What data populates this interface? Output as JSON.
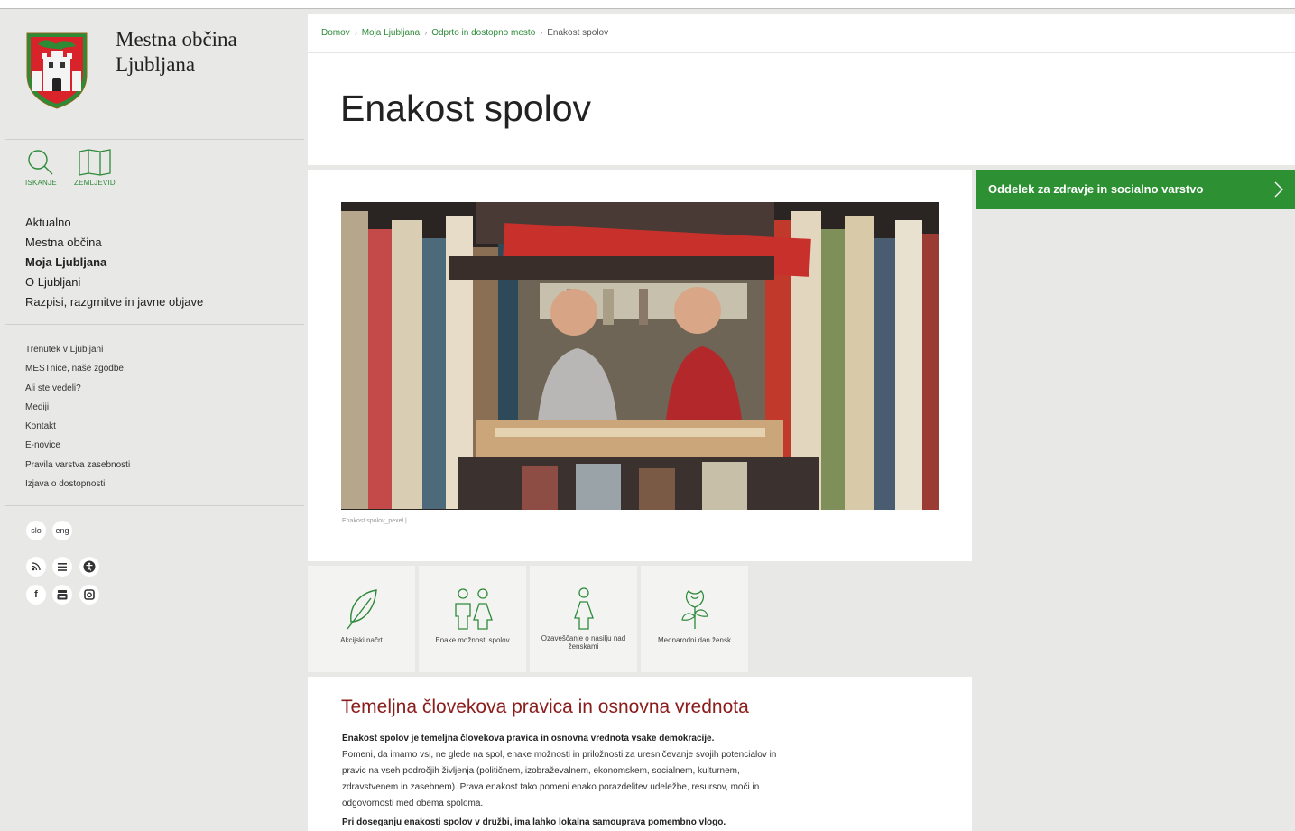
{
  "site": {
    "name_line1": "Mestna občina",
    "name_line2": "Ljubljana"
  },
  "tools": {
    "search_label": "ISKANJE",
    "map_label": "ZEMLJEVID"
  },
  "main_nav": [
    {
      "label": "Aktualno",
      "active": false
    },
    {
      "label": "Mestna občina",
      "active": false
    },
    {
      "label": "Moja Ljubljana",
      "active": true
    },
    {
      "label": "O Ljubljani",
      "active": false
    },
    {
      "label": "Razpisi, razgrnitve in javne objave",
      "active": false
    }
  ],
  "sub_nav": [
    "Trenutek v Ljubljani",
    "MESTnice, naše zgodbe",
    "Ali ste vedeli?",
    "Mediji",
    "Kontakt",
    "E-novice",
    "Pravila varstva zasebnosti",
    "Izjava o dostopnosti"
  ],
  "languages": {
    "slo": "slo",
    "eng": "eng"
  },
  "social_icons": [
    "rss-icon",
    "list-icon",
    "accessibility-icon",
    "facebook-icon",
    "youtube-icon",
    "instagram-icon"
  ],
  "breadcrumb": [
    "Domov",
    "Moja Ljubljana",
    "Odprto in dostopno mesto",
    "Enakost spolov"
  ],
  "page": {
    "title": "Enakost spolov"
  },
  "hero": {
    "caption": "Enakost spolov_pexel |"
  },
  "tiles": [
    {
      "label": "Akcijski načrt",
      "icon": "feather-icon"
    },
    {
      "label": "Enake možnosti spolov",
      "icon": "man-woman-icon"
    },
    {
      "label": "Ozaveščanje o nasilju nad ženskami",
      "icon": "woman-icon"
    },
    {
      "label": "Mednarodni dan žensk",
      "icon": "rose-icon"
    }
  ],
  "article": {
    "heading": "Temeljna človekova pravica in osnovna vrednota",
    "lead": "Enakost spolov je temeljna človekova pravica in osnovna vrednota vsake demokracije.",
    "body": "Pomeni, da imamo vsi, ne glede na spol, enake možnosti in priložnosti za uresničevanje svojih potencialov in pravic na vseh področjih življenja (političnem, izobraževalnem, ekonomskem, socialnem, kulturnem, zdravstvenem in zasebnem). Prava enakost tako pomeni enako porazdelitev udeležbe, resursov, moči in odgovornosti med obema spoloma.",
    "p2": "Pri doseganju enakosti spolov v družbi, ima lahko lokalna samouprava pomembno vlogo."
  },
  "department": {
    "label": "Oddelek za zdravje in socialno varstvo"
  },
  "colors": {
    "accent_green": "#2d9133",
    "heading_red": "#8b1c1c",
    "sidebar_bg": "#e8e8e6"
  }
}
